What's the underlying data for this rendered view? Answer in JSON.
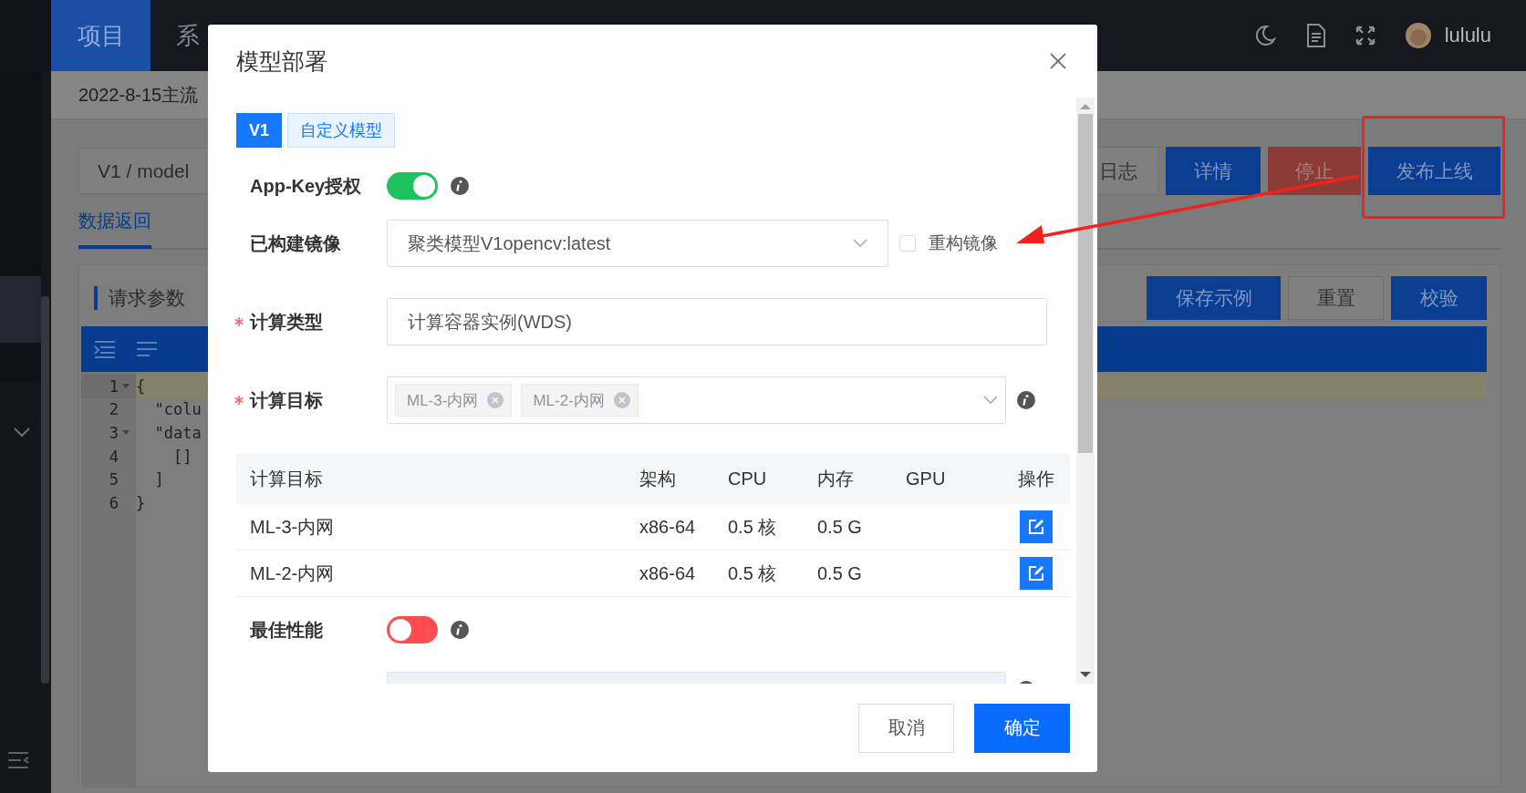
{
  "topbar": {
    "nav": [
      {
        "label": "项目",
        "selected": true
      },
      {
        "label": "系",
        "selected": false
      }
    ],
    "user": "lululu"
  },
  "breadcrumb": "2022-8-15主流",
  "version_path": "V1 / model",
  "actions": [
    {
      "label": "日志",
      "kind": "default"
    },
    {
      "label": "详情",
      "kind": "primary"
    },
    {
      "label": "停止",
      "kind": "danger"
    },
    {
      "label": "发布上线",
      "kind": "primary"
    }
  ],
  "result_tabs": [
    {
      "label": "数据返回",
      "selected": true
    }
  ],
  "request": {
    "title": "请求参数",
    "buttons": [
      {
        "label": "保存示例",
        "kind": "primary"
      },
      {
        "label": "重置",
        "kind": "default"
      },
      {
        "label": "校验",
        "kind": "primary"
      }
    ]
  },
  "editor": {
    "lines": [
      {
        "number": "1",
        "text": "{",
        "foldable": true,
        "active": true
      },
      {
        "number": "2",
        "text": "  \"colu",
        "foldable": false,
        "active": false
      },
      {
        "number": "3",
        "text": "  \"data",
        "foldable": true,
        "active": false
      },
      {
        "number": "4",
        "text": "    []",
        "foldable": false,
        "active": false
      },
      {
        "number": "5",
        "text": "  ]",
        "foldable": false,
        "active": false
      },
      {
        "number": "6",
        "text": "}",
        "foldable": false,
        "active": false
      }
    ]
  },
  "dialog": {
    "title": "模型部署",
    "version_tabs": [
      {
        "label": "V1",
        "selected": true
      },
      {
        "label": "自定义模型",
        "selected": false
      }
    ],
    "fields": [
      {
        "kind": "switch",
        "label": "App-Key授权",
        "on": true,
        "info": true
      },
      {
        "kind": "select",
        "label": "已构建镜像",
        "value": "聚类模型V1opencv:latest",
        "rebuild": {
          "label": "重构镜像",
          "checked": false
        }
      },
      {
        "kind": "input",
        "label": "计算类型",
        "required": true,
        "value": "计算容器实例(WDS)"
      },
      {
        "kind": "tags",
        "label": "计算目标",
        "required": true,
        "tags": [
          "ML-3-内网",
          "ML-2-内网"
        ],
        "info": true
      },
      {
        "kind": "table",
        "columns": [
          "计算目标",
          "架构",
          "CPU",
          "内存",
          "GPU",
          "操作"
        ],
        "rows": [
          {
            "target": "ML-3-内网",
            "arch": "x86-64",
            "cpu": "0.5 核",
            "memory": "0.5 G"
          },
          {
            "target": "ML-2-内网",
            "arch": "x86-64",
            "cpu": "0.5 核",
            "memory": "0.5 G"
          }
        ]
      },
      {
        "kind": "switch",
        "label": "最佳性能",
        "on": false,
        "info": true
      },
      {
        "kind": "textarea",
        "disabled": true,
        "info": true
      }
    ],
    "footer": [
      {
        "label": "取消",
        "kind": "default"
      },
      {
        "label": "确定",
        "kind": "primary"
      }
    ]
  }
}
